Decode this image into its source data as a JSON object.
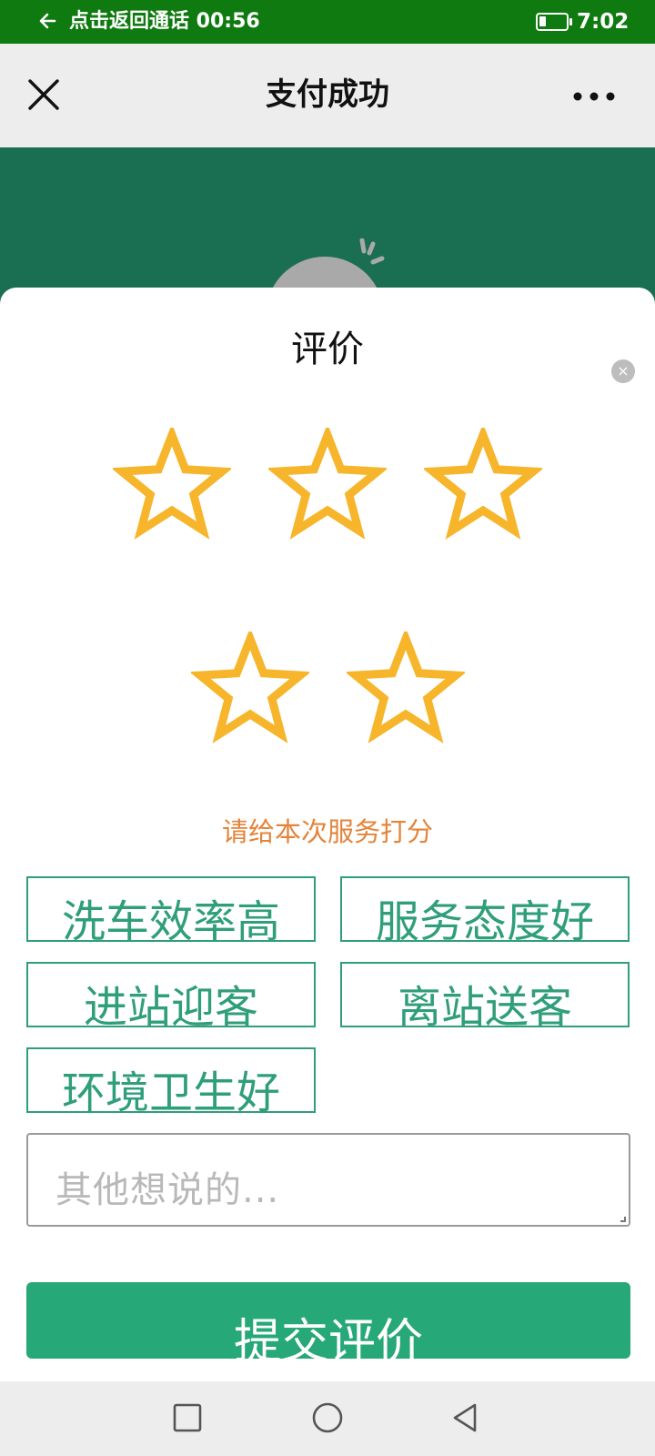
{
  "status_bar": {
    "call_text": "点击返回通话 00:56",
    "time": "7:02",
    "battery_level": 0.25,
    "back_icon": "arrow-left-icon",
    "battery_icon": "battery-icon"
  },
  "header": {
    "title": "支付成功",
    "close_icon": "close-icon",
    "more_icon": "more-horizontal-icon"
  },
  "sheet": {
    "title": "评价",
    "close_label": "×",
    "rating_max": 5,
    "rating_value": 0,
    "star_icon": "star-outline-icon",
    "star_color": "#f7b52c",
    "rate_hint": "请给本次服务打分",
    "tags": [
      {
        "label": "洗车效率高"
      },
      {
        "label": "服务态度好"
      },
      {
        "label": "进站迎客"
      },
      {
        "label": "离站送客"
      },
      {
        "label": "环境卫生好"
      }
    ],
    "comment": {
      "value": "",
      "placeholder": "其他想说的..."
    },
    "submit_label": "提交评价"
  },
  "colors": {
    "status_bar": "#0f7a0f",
    "hero": "#1a6e51",
    "accent": "#27a878",
    "tag": "#2f9e7a",
    "hint": "#e3843a"
  },
  "nav_bar": {
    "recent_icon": "square-icon",
    "home_icon": "circle-icon",
    "back_icon": "triangle-back-icon"
  }
}
